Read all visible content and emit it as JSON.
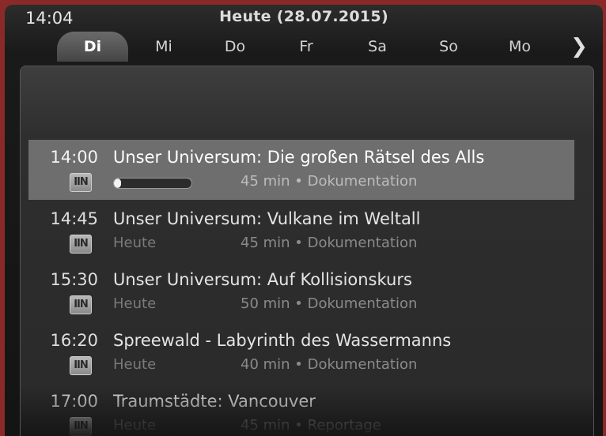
{
  "header": {
    "clock": "14:04",
    "title": "Heute (28.07.2015)"
  },
  "tabs": [
    {
      "label": "Di",
      "active": true
    },
    {
      "label": "Mi"
    },
    {
      "label": "Do"
    },
    {
      "label": "Fr"
    },
    {
      "label": "Sa"
    },
    {
      "label": "So"
    },
    {
      "label": "Mo"
    }
  ],
  "next_arrow": "❯",
  "category_icon_text": "IIN",
  "programmes": [
    {
      "time": "14:00",
      "title": "Unser Universum: Die großen Rätsel des Alls",
      "day": "",
      "meta": "45 min • Dokumentation",
      "progress": 0.09,
      "selected": true
    },
    {
      "time": "14:45",
      "title": "Unser Universum: Vulkane im Weltall",
      "day": "Heute",
      "meta": "45 min • Dokumentation"
    },
    {
      "time": "15:30",
      "title": "Unser Universum: Auf Kollisionskurs",
      "day": "Heute",
      "meta": "50 min • Dokumentation"
    },
    {
      "time": "16:20",
      "title": "Spreewald - Labyrinth des Wassermanns",
      "day": "Heute",
      "meta": "40 min • Dokumentation"
    },
    {
      "time": "17:00",
      "title": "Traumstädte: Vancouver",
      "day": "Heute",
      "meta": "45 min • Reportage"
    }
  ],
  "colors": {
    "frame_border": "#8a2a28",
    "selected_row": "#6e6e6e",
    "text": "#e4e4e4"
  }
}
